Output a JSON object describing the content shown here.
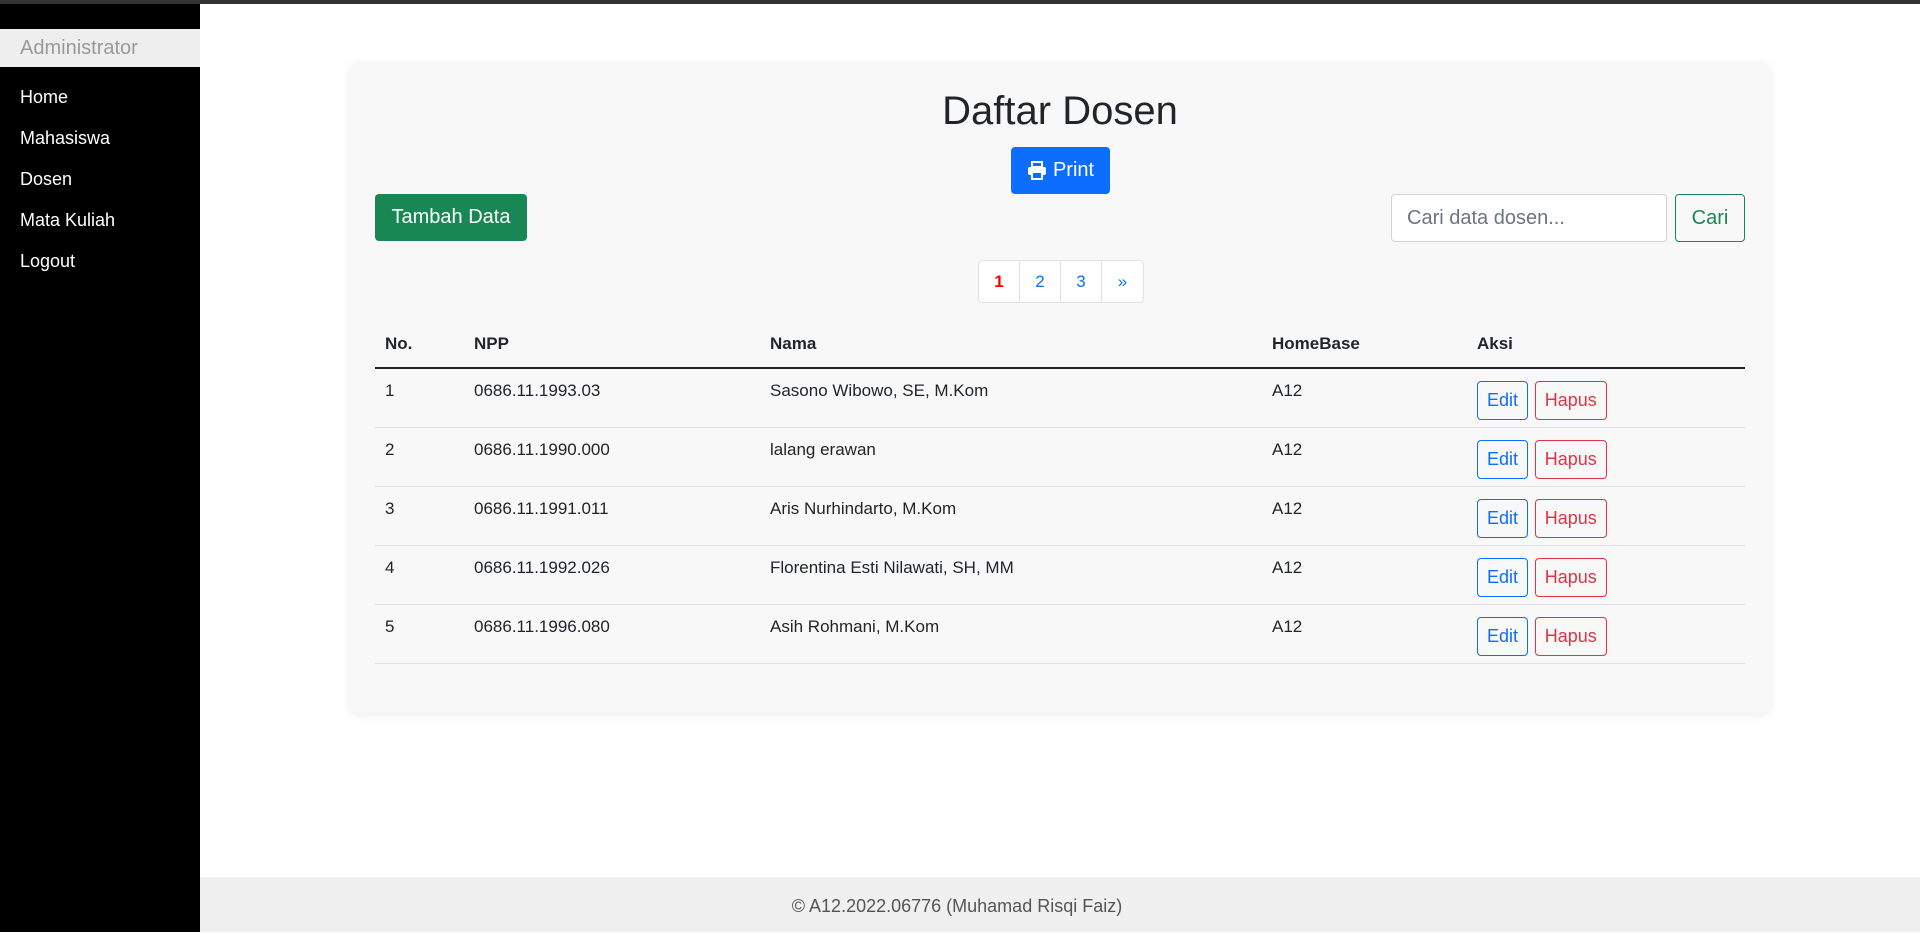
{
  "sidebar": {
    "brand": "Administrator",
    "items": [
      {
        "label": "Home"
      },
      {
        "label": "Mahasiswa"
      },
      {
        "label": "Dosen"
      },
      {
        "label": "Mata Kuliah"
      },
      {
        "label": "Logout"
      }
    ]
  },
  "main": {
    "title": "Daftar Dosen",
    "print_label": "Print",
    "add_label": "Tambah Data",
    "search": {
      "placeholder": "Cari data dosen...",
      "value": "",
      "button_label": "Cari"
    },
    "pagination": {
      "pages": [
        "1",
        "2",
        "3"
      ],
      "next": "»",
      "active": "1"
    },
    "table": {
      "headers": [
        "No.",
        "NPP",
        "Nama",
        "HomeBase",
        "Aksi"
      ],
      "edit_label": "Edit",
      "delete_label": "Hapus",
      "rows": [
        {
          "no": "1",
          "npp": "0686.11.1993.03",
          "nama": "Sasono Wibowo, SE, M.Kom",
          "homebase": "A12"
        },
        {
          "no": "2",
          "npp": "0686.11.1990.000",
          "nama": "lalang erawan",
          "homebase": "A12"
        },
        {
          "no": "3",
          "npp": "0686.11.1991.011",
          "nama": "Aris Nurhindarto, M.Kom",
          "homebase": "A12"
        },
        {
          "no": "4",
          "npp": "0686.11.1992.026",
          "nama": "Florentina Esti Nilawati, SH, MM",
          "homebase": "A12"
        },
        {
          "no": "5",
          "npp": "0686.11.1996.080",
          "nama": "Asih Rohmani, M.Kom",
          "homebase": "A12"
        }
      ]
    }
  },
  "footer": {
    "text": "© A12.2022.06776 (Muhamad Risqi Faiz)"
  },
  "colors": {
    "primary": "#0d6efd",
    "success": "#198754",
    "danger": "#dc3545",
    "active_page": "#ff0000",
    "sidebar_bg": "#000000"
  },
  "icons": {
    "print": "printer-icon"
  }
}
